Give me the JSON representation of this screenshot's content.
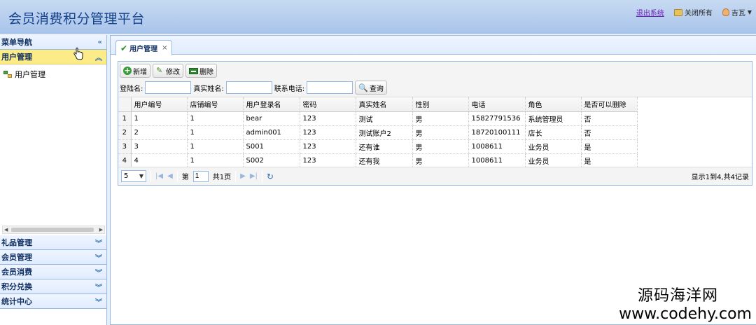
{
  "header": {
    "title": "会员消费积分管理平台",
    "logout": "退出系统",
    "close_all": "关闭所有",
    "user": "吉瓦"
  },
  "sidebar": {
    "title": "菜单导航",
    "active_group": "用户管理",
    "active_items": [
      "用户管理"
    ],
    "groups": [
      "礼品管理",
      "会员管理",
      "会员消费",
      "积分兑换",
      "统计中心"
    ]
  },
  "tab": {
    "label": "用户管理"
  },
  "toolbar": {
    "add": "新增",
    "edit": "修改",
    "delete": "删除",
    "login_label": "登陆名:",
    "realname_label": "真实姓名:",
    "phone_label": "联系电话:",
    "query": "查询"
  },
  "grid": {
    "columns": [
      "用户编号",
      "店铺编号",
      "用户登录名",
      "密码",
      "真实姓名",
      "性别",
      "电话",
      "角色",
      "是否可以删除"
    ],
    "rows": [
      [
        "1",
        "1",
        "1",
        "bear",
        "123",
        "测试",
        "男",
        "15827791536",
        "系统管理员",
        "否"
      ],
      [
        "2",
        "2",
        "1",
        "admin001",
        "123",
        "测试账户2",
        "男",
        "18720100111",
        "店长",
        "否"
      ],
      [
        "3",
        "3",
        "1",
        "S001",
        "123",
        "还有谁",
        "男",
        "1008611",
        "业务员",
        "是"
      ],
      [
        "4",
        "4",
        "1",
        "S002",
        "123",
        "还有我",
        "男",
        "1008611",
        "业务员",
        "是"
      ]
    ]
  },
  "pager": {
    "page_size": "5",
    "page_prefix": "第",
    "page_value": "1",
    "page_total": "共1页",
    "info": "显示1到4,共4记录"
  },
  "watermark": {
    "line1": "源码海洋网",
    "line2": "www.codehy.com"
  }
}
